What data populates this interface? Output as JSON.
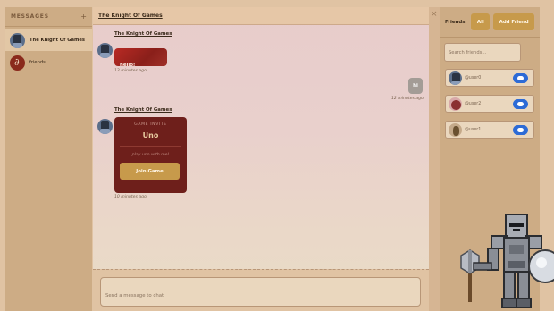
{
  "sidebar": {
    "title": "MESSAGES",
    "plus": "+",
    "items": [
      {
        "name": "The Knight Of Games",
        "avatar": "knight-avatar"
      },
      {
        "name": "friends",
        "avatar": "group-avatar"
      }
    ]
  },
  "chat": {
    "title": "The Knight Of Games",
    "messages": [
      {
        "sender": "The Knight Of Games",
        "text": "hello!",
        "time": "13 minutes ago"
      },
      {
        "sender": "me",
        "text": "hi",
        "time": "12 minutes ago"
      },
      {
        "sender": "The Knight Of Games",
        "invite": {
          "label": "GAME INVITE",
          "game": "Uno",
          "sub": "play uno with me!",
          "button": "Join Game"
        },
        "time": "10 minutes ago"
      }
    ],
    "composer_placeholder": "Send a message to chat",
    "close": "×"
  },
  "friends": {
    "title": "Friends",
    "all_label": "All",
    "add_label": "Add Friend",
    "search_placeholder": "Search friends...",
    "list": [
      {
        "name": "@user0"
      },
      {
        "name": "@user2"
      },
      {
        "name": "@user1"
      }
    ]
  },
  "colors": {
    "accent": "#c79a4b",
    "panel": "#cdac85",
    "chat_button": "#2d6bd6",
    "bubble_red": "#8a1f1a",
    "invite_bg": "#6e1f1b"
  }
}
